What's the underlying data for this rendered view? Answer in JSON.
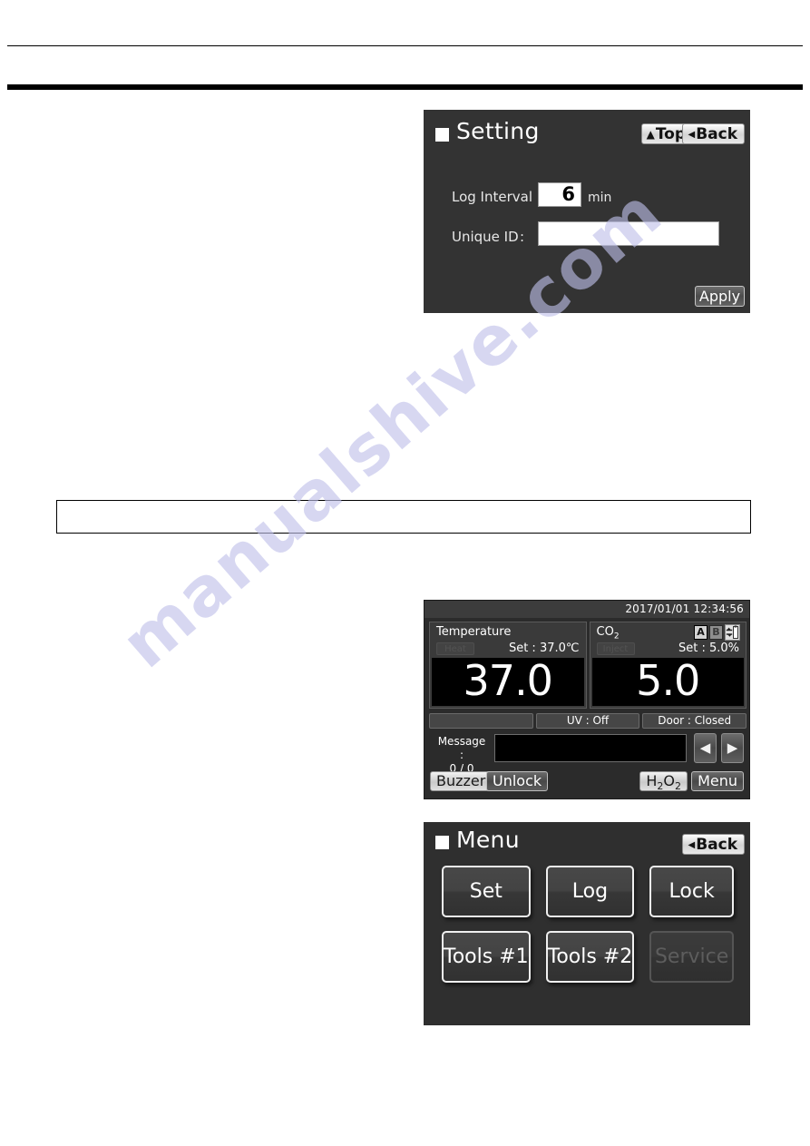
{
  "page": {
    "watermark_text": "manualshive.com",
    "note_box_text": ""
  },
  "setting_panel": {
    "title": "Setting",
    "buttons": {
      "top": "Top",
      "back": "Back",
      "apply": "Apply"
    },
    "fields": [
      {
        "label": "Log Interval :",
        "value": "6",
        "unit": "min"
      },
      {
        "label": "Unique ID",
        "colon": ":",
        "value": ""
      }
    ]
  },
  "main_panel": {
    "clock": "2017/01/01  12:34:56",
    "temperature": {
      "name": "Temperature",
      "status_badge": "Heat",
      "set_label": "Set : 37.0℃",
      "value": "37.0"
    },
    "co2": {
      "name": "CO",
      "name_sub": "2",
      "status_badge": "Inject",
      "set_label": "Set :  5.0%",
      "value": "5.0",
      "gas_a": "A",
      "gas_b": "B",
      "gas_auto_icon": "gas-cylinder-auto-switch-icon"
    },
    "status_row": [
      {
        "text": "",
        "empty": true
      },
      {
        "text": "UV : Off",
        "empty": false
      },
      {
        "text": "Door : Closed",
        "empty": false
      }
    ],
    "message": {
      "label": "Message :",
      "counter": "0 / 0",
      "text": "",
      "prev_icon": "◀",
      "next_icon": "▶"
    },
    "bottom_buttons": {
      "buzzer": "Buzzer",
      "unlock": "Unlock",
      "h2o2": "H",
      "h2o2_sub1": "2",
      "h2o2_mid": "O",
      "h2o2_sub2": "2",
      "menu": "Menu"
    }
  },
  "menu_panel": {
    "title": "Menu",
    "back": "Back",
    "items": [
      {
        "label": "Set",
        "disabled": false
      },
      {
        "label": "Log",
        "disabled": false
      },
      {
        "label": "Lock",
        "disabled": false
      },
      {
        "label": "Tools #1",
        "disabled": false
      },
      {
        "label": "Tools #2",
        "disabled": false
      },
      {
        "label": "Service",
        "disabled": true
      }
    ]
  },
  "colors": {
    "panel_bg": "#333333",
    "panel_bg_alt": "#2b2b2b",
    "field_bg": "#ffffff",
    "value_bg": "#000000",
    "watermark": "#bfc0ea"
  }
}
